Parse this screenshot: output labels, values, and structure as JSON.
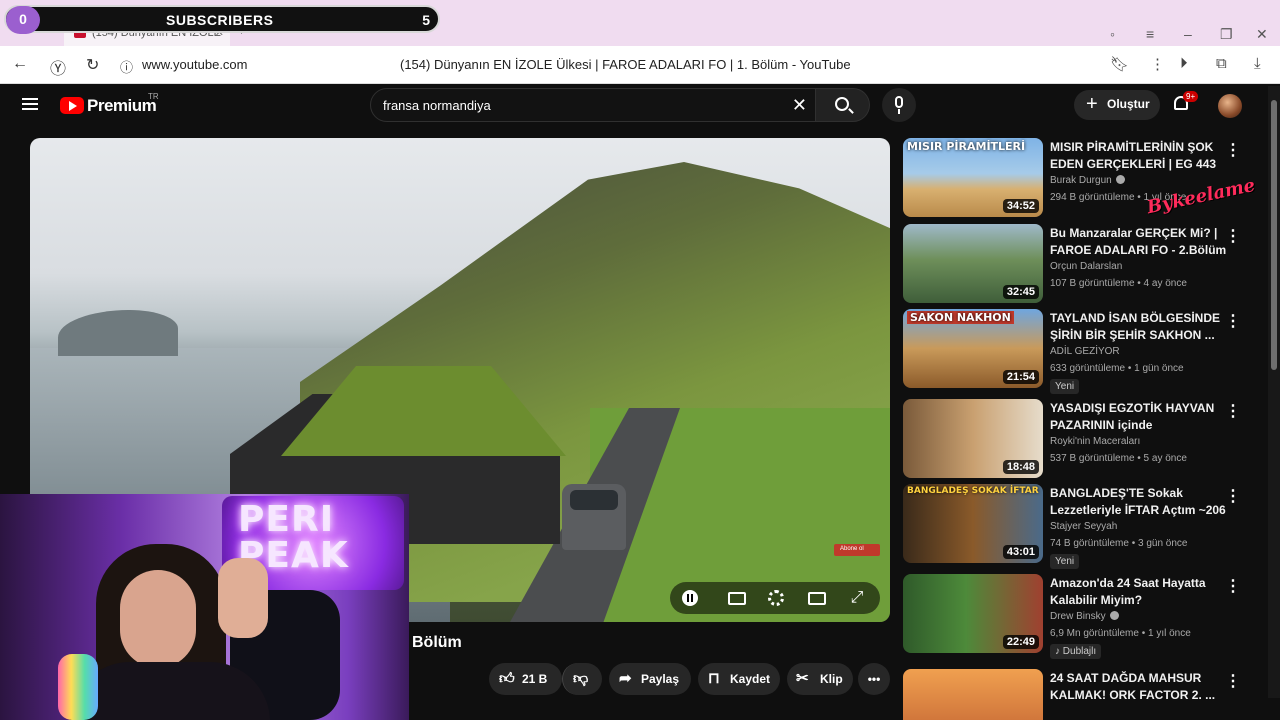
{
  "browser": {
    "tab_title": "(154) Dünyanın EN İZOLE",
    "url": "www.youtube.com",
    "page_title": "(154) Dünyanın EN İZOLE Ülkesi | FAROE ADALARI FO | 1. Bölüm - YouTube"
  },
  "overlay": {
    "count": "0",
    "label": "SUBSCRIBERS",
    "goal": "5",
    "neon_sign": "PERI PEAK",
    "sticker": "Bykeelame"
  },
  "header": {
    "brand": "Premium",
    "region": "TR",
    "search_query": "fransa normandiya",
    "create_label": "Oluştur",
    "notif_badge": "9+"
  },
  "player": {
    "corner_tag": "Abone ol"
  },
  "video": {
    "title_tail": "Bölüm",
    "likes": "21 B",
    "share_label": "Paylaş",
    "save_label": "Kaydet",
    "clip_label": "Klip"
  },
  "recommendations": [
    {
      "title": "MISIR PİRAMİTLERİNİN ŞOK EDEN GERÇEKLERİ | EG 443",
      "channel": "Burak Durgun",
      "verified": true,
      "meta": "294 B görüntüleme • 1 yıl önce",
      "duration": "34:52",
      "thumb_text": "MISIR PİRAMİTLERİ",
      "badge": ""
    },
    {
      "title": "Bu Manzaralar GERÇEK Mi? | FAROE ADALARI FO - 2.Bölüm",
      "channel": "Orçun Dalarslan",
      "verified": false,
      "meta": "107 B görüntüleme • 4 ay önce",
      "duration": "32:45",
      "thumb_text": "",
      "badge": ""
    },
    {
      "title": "TAYLAND İSAN BÖLGESİNDE ŞİRİN BİR ŞEHİR SAKHON ...",
      "channel": "ADİL GEZİYOR",
      "verified": false,
      "meta": "633 görüntüleme • 1 gün önce",
      "duration": "21:54",
      "thumb_text": "SAKON NAKHON",
      "badge": "Yeni"
    },
    {
      "title": "YASADIŞI EGZOTİK HAYVAN PAZARININ içinde",
      "channel": "Royki'nin Maceraları",
      "verified": false,
      "meta": "537 B görüntüleme • 5 ay önce",
      "duration": "18:48",
      "thumb_text": "",
      "badge": ""
    },
    {
      "title": "BANGLADEŞ'TE Sokak Lezzetleriyle İFTAR Açtım ~206",
      "channel": "Stajyer Seyyah",
      "verified": false,
      "meta": "74 B görüntüleme • 3 gün önce",
      "duration": "43:01",
      "thumb_text": "BANGLADEŞ SOKAK İFTAR",
      "badge": "Yeni"
    },
    {
      "title": "Amazon'da 24 Saat Hayatta Kalabilir Miyim?",
      "channel": "Drew Binsky",
      "verified": true,
      "meta": "6,9 Mn görüntüleme • 1 yıl önce",
      "duration": "22:49",
      "thumb_text": "",
      "badge": "Dublajlı"
    },
    {
      "title": "24 SAAT DAĞDA MAHSUR KALMAK! ORK FACTOR 2. ...",
      "channel": "",
      "verified": false,
      "meta": "",
      "duration": "",
      "thumb_text": "",
      "badge": ""
    }
  ],
  "colors": {
    "accent": "#ff0000",
    "overlay_circle": "#9b5fcf",
    "tab_strip": "#f0dcf0"
  }
}
